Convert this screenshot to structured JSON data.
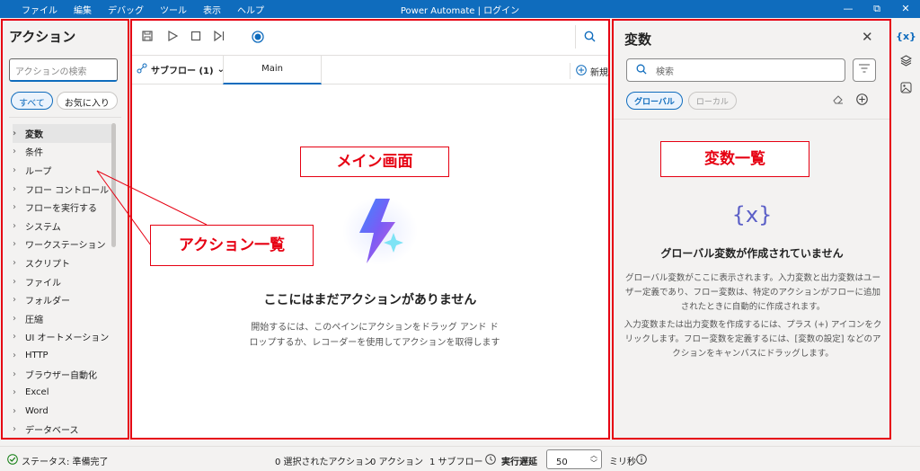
{
  "window": {
    "title": "Power Automate | ログイン",
    "menu": [
      "ファイル",
      "編集",
      "デバッグ",
      "ツール",
      "表示",
      "ヘルプ"
    ],
    "controls": [
      "—",
      "⧉",
      "✕"
    ]
  },
  "actions_pane": {
    "title": "アクション",
    "search_placeholder": "アクションの検索",
    "filters": [
      "すべて",
      "お気に入り"
    ],
    "items": [
      "変数",
      "条件",
      "ループ",
      "フロー コントロール",
      "フローを実行する",
      "システム",
      "ワークステーション",
      "スクリプト",
      "ファイル",
      "フォルダー",
      "圧縮",
      "UI オートメーション",
      "HTTP",
      "ブラウザー自動化",
      "Excel",
      "Word",
      "データベース"
    ]
  },
  "center": {
    "subflow_label": "サブフロー (1)",
    "tab_main": "Main",
    "new_label": "新規",
    "empty_title": "ここにはまだアクションがありません",
    "empty_desc": "開始するには、このペインにアクションをドラッグ アンド ドロップするか、レコーダーを使用してアクションを取得します"
  },
  "variables_pane": {
    "title": "変数",
    "search_placeholder": "検索",
    "filters": [
      "グローバル",
      "ローカル"
    ],
    "empty_title": "グローバル変数が作成されていません",
    "desc1": "グローバル変数がここに表示されます。入力変数と出力変数はユーザー定義であり、フロー変数は、特定のアクションがフローに追加されたときに自動的に作成されます。",
    "desc2": "入力変数または出力変数を作成するには、プラス (+) アイコンをクリックします。フロー変数を定義するには、[変数の設定] などのアクションをキャンバスにドラッグします。"
  },
  "status_bar": {
    "status": "ステータス: 準備完了",
    "selected": "0 選択されたアクション",
    "actions": "0 アクション",
    "subflows": "1 サブフロー",
    "delay_label": "実行遅延",
    "delay_value": "50",
    "unit": "ミリ秒"
  },
  "annotations": {
    "main": "メイン画面",
    "actions": "アクション一覧",
    "vars": "変数一覧"
  },
  "colors": {
    "accent": "#0f6cbd",
    "annotation": "#e60012"
  }
}
